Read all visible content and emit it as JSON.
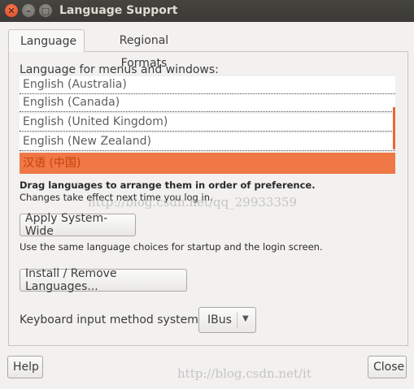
{
  "window": {
    "title": "Language Support"
  },
  "tabs": [
    {
      "label": "Language"
    },
    {
      "label": "Regional Formats"
    }
  ],
  "language": {
    "list_label": "Language for menus and windows:",
    "items": [
      {
        "label": "English (Australia)"
      },
      {
        "label": "English (Canada)"
      },
      {
        "label": "English (United Kingdom)"
      },
      {
        "label": "English (New Zealand)"
      },
      {
        "label": "汉语 (中国)"
      }
    ],
    "hint_bold": "Drag languages to arrange them in order of preference.",
    "hint_text": "Changes take effect next time you log in.",
    "apply_label": "Apply System-Wide",
    "apply_note": "Use the same language choices for startup and the login screen.",
    "install_label": "Install / Remove Languages...",
    "keyboard_label": "Keyboard input method system:",
    "keyboard_value": "IBus"
  },
  "footer": {
    "help_label": "Help",
    "close_label": "Close"
  },
  "watermarks": [
    "http://blog.csdn.net/qq_29933359",
    "http://blog.csdn.net/it"
  ],
  "colors": {
    "accent": "#f07746",
    "titlebar": "#3b3a36"
  },
  "icons": {
    "close": "close-icon",
    "minimize": "minimize-icon",
    "maximize": "maximize-icon",
    "dropdown": "chevron-down-icon"
  }
}
